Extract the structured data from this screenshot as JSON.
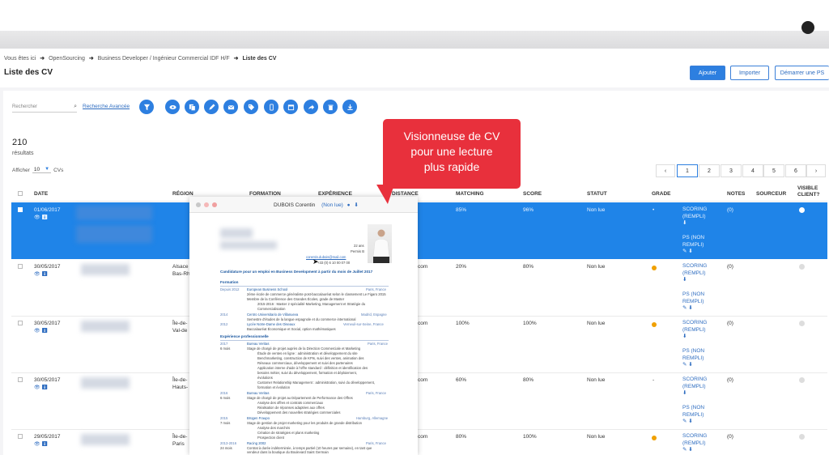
{
  "breadcrumb": {
    "prefix": "Vous êtes ici",
    "items": [
      "OpenSourcing",
      "Business Developer / Ingénieur Commercial IDF H/F",
      "Liste des CV"
    ]
  },
  "page_title": "Liste des CV",
  "header_buttons": {
    "add": "Ajouter",
    "import": "Importer",
    "start": "Démarrer une PS"
  },
  "toolbar": {
    "search_placeholder": "Rechercher",
    "advanced_search": "Recherche Avancée",
    "icons": [
      "filter-icon",
      "eye-icon",
      "copy-icon",
      "pencil-icon",
      "envelope-icon",
      "tag-icon",
      "mobile-icon",
      "calendar-icon",
      "share-icon",
      "trash-icon",
      "download-icon"
    ]
  },
  "results": {
    "count": "210",
    "label": "résultats"
  },
  "show": {
    "prefix": "Afficher",
    "value": "10",
    "suffix": "CVs"
  },
  "pagination": {
    "prev": "‹",
    "pages": [
      "1",
      "2",
      "3",
      "4",
      "5",
      "6"
    ],
    "next": "›",
    "active": "1"
  },
  "table": {
    "headers": {
      "date": "DATE",
      "region": "RÉGION",
      "formation": "FORMATION",
      "experience": "EXPÉRIENCE",
      "distance": "DISTANCE",
      "matching": "MATCHING",
      "score": "SCORE",
      "statut": "STATUT",
      "grade": "GRADE",
      "notes": "NOTES",
      "sourceur": "SOURCEUR",
      "visible_1": "VISIBLE",
      "visible_2": "CLIENT?"
    },
    "rows": [
      {
        "date": "01/06/2017",
        "region_1": "",
        "region_2": "",
        "matching": "85%",
        "score": "96%",
        "statut": "Non lue",
        "grade": "•",
        "scoring_1": "SCORING",
        "scoring_2": "(REMPLI)",
        "ps_1": "PS (NON",
        "ps_2": "REMPLI)",
        "notes": "(0)"
      },
      {
        "date": "30/05/2017",
        "region_1": "Alsace",
        "region_2": "Bas-Rh",
        "distance": "com",
        "matching": "20%",
        "score": "80%",
        "statut": "Non lue",
        "scoring_1": "SCORING",
        "scoring_2": "(REMPLI)",
        "ps_1": "PS (NON",
        "ps_2": "REMPLI)",
        "notes": "(0)"
      },
      {
        "date": "30/05/2017",
        "region_1": "Île-de-",
        "region_2": "Val-de",
        "distance": "com",
        "matching": "100%",
        "score": "100%",
        "statut": "Non lue",
        "scoring_1": "SCORING",
        "scoring_2": "(REMPLI)",
        "ps_1": "PS (NON",
        "ps_2": "REMPLI)",
        "notes": "(0)"
      },
      {
        "date": "30/05/2017",
        "region_1": "Île-de-",
        "region_2": "Hauts-",
        "distance": "com",
        "matching": "60%",
        "score": "80%",
        "statut": "Non lue",
        "grade": "-",
        "scoring_1": "SCORING",
        "scoring_2": "(REMPLI)",
        "ps_1": "PS (NON",
        "ps_2": "REMPLI)",
        "notes": "(0)"
      },
      {
        "date": "29/05/2017",
        "region_1": "Île-de-",
        "region_2": "Paris",
        "distance": "com",
        "matching": "80%",
        "score": "100%",
        "statut": "Non lue",
        "scoring_1": "SCORING",
        "scoring_2": "(REMPLI)",
        "notes": "(0)"
      }
    ]
  },
  "viewer": {
    "title": "DUBOIS Corentin",
    "status": "(Non lue)",
    "cv": {
      "age": "22 ans",
      "permis": "Permis B",
      "email": "corentin.dubois@mail.com",
      "phone": "+33 (0) 6 10 00 07 00",
      "headline": "Candidature pour un emploi en Business Development à partir du mois de Juillet 2017",
      "section_formation": "Formation",
      "f1_date": "Depuis 2012",
      "f1_school": "European Business School",
      "f1_place": "Paris, France",
      "f1_l1": "2ème école de commerce généraliste post-baccalauréat selon le classement Le Figaro 2015",
      "f1_l2": "Membre de la Conférence des Grandes Écoles, grade de Master",
      "f1_l3": "2015-2016 : Master 2 spécialité Marketing, Management et Stratégie du",
      "f1_l4": "Commercialisation",
      "f2_date": "2014",
      "f2_school": "Centro Universitario de Villanueva",
      "f2_place": "Madrid, Espagne",
      "f2_l1": "Semestre d'études de la langue espagnole et du commerce international",
      "f3_date": "2012",
      "f3_school": "Lycée Notre-Dame des Oiseaux",
      "f3_place": "Verneuil-sur-Seine, France",
      "f3_l1": "Baccalauréat Économique et Social, option mathématiques",
      "section_exp": "Expérience professionnelle",
      "e1_date": "2017",
      "e1_dur": "6 mois",
      "e1_company": "Bureau Veritas",
      "e1_place": "Paris, France",
      "e1_l1": "Stage de chargé de projet auprès de la Direction Commerciale et Marketing",
      "e1_l2": "Étude de ventes en ligne : administration et développement du site",
      "e1_l3": "Benchmarketing, construction de KPIs, suivi des ventes, animation des",
      "e1_l4": "Réseaux commerciaux, développement et suivi des partenaires",
      "e1_l5": "Application interne d'aide à l'offre standard : définition et identification des",
      "e1_l6": "besoins métier, suivi du développement, formation et déploiement,",
      "e1_l7": "évolutions",
      "e1_l8": "Customer Relationship Management : administration, suivi du développement,",
      "e1_l9": "formation et évolution",
      "e2_date": "2016",
      "e2_dur": "6 mois",
      "e2_company": "Bureau Veritas",
      "e2_place": "Paris, France",
      "e2_l1": "Stage de chargé de projet au Département de Performance des Offres",
      "e2_l2": "Analyse des offres et contrats commerciaux",
      "e2_l3": "Réalisation de réponses adaptées aux offres",
      "e2_l4": "Développement des nouvelles stratégies commerciales",
      "e3_date": "2015",
      "e3_dur": "7 mois",
      "e3_company": "Brügen Fraupo",
      "e3_place": "Hamburg, Allemagne",
      "e3_l1": "Stage de gestion de projet marketing pour les produits de grande distribution",
      "e3_l2": "Analyse des marchés",
      "e3_l3": "Création de stratégies et plans marketing",
      "e3_l4": "Prospection client",
      "e4_date": "2013-2016",
      "e4_dur": "24 mois",
      "e4_company": "Racing 2002",
      "e4_place": "Paris, France",
      "e4_l1": "Contrat à durée indéterminée, à temps partiel (10 heures par semaine), en tant que",
      "e4_l2": "vendeur dans la boutique du Boulevard Saint Germain"
    }
  },
  "callout": {
    "line1": "Visionneuse de CV",
    "line2": "pour une lecture",
    "line3": "plus rapide"
  },
  "colors": {
    "accent": "#2d7fe0",
    "selected_row": "#1f84e8",
    "callout": "#e8303c",
    "grade_orange": "#f0a000"
  }
}
